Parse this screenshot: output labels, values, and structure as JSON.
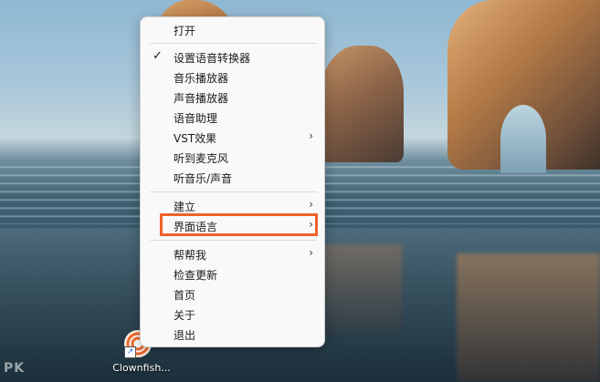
{
  "menu": {
    "items": [
      {
        "label": "打开"
      },
      {
        "label": "设置语音转换器",
        "checked": true
      },
      {
        "label": "音乐播放器"
      },
      {
        "label": "声音播放器"
      },
      {
        "label": "语音助理"
      },
      {
        "label": "VST效果",
        "submenu": true
      },
      {
        "label": "听到麦克风"
      },
      {
        "label": "听音乐/声音"
      },
      {
        "label": "建立",
        "submenu": true
      },
      {
        "label": "界面语言",
        "submenu": true,
        "highlighted": true
      },
      {
        "label": "帮帮我",
        "submenu": true
      },
      {
        "label": "检查更新"
      },
      {
        "label": "首页"
      },
      {
        "label": "关于"
      },
      {
        "label": "退出"
      }
    ],
    "check_glyph": "✓",
    "submenu_glyph": "›",
    "highlight_color": "#f0612a"
  },
  "desktop": {
    "icon_label": "Clownfish...",
    "shortcut_glyph": "↗",
    "watermark": "PK"
  }
}
